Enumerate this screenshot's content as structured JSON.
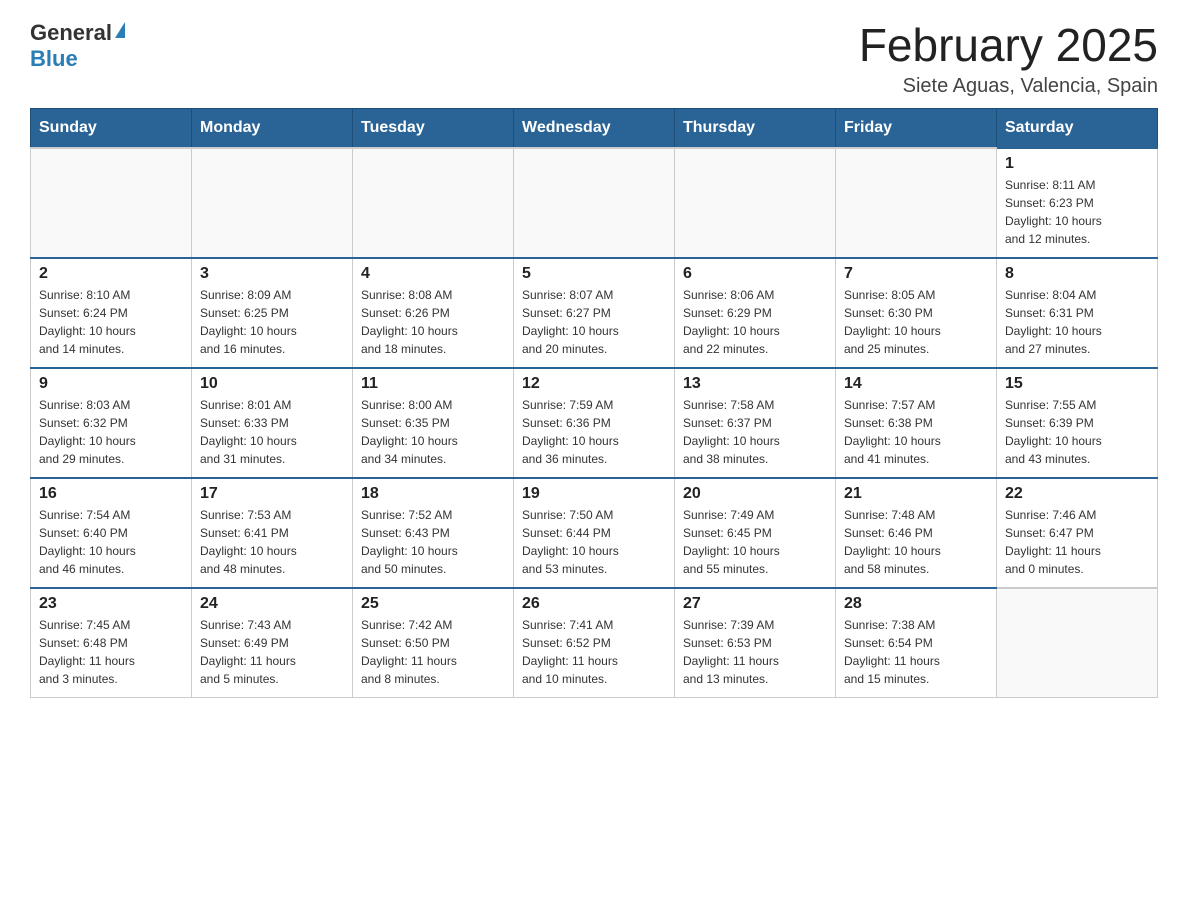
{
  "logo": {
    "general": "General",
    "blue": "Blue"
  },
  "title": "February 2025",
  "location": "Siete Aguas, Valencia, Spain",
  "weekdays": [
    "Sunday",
    "Monday",
    "Tuesday",
    "Wednesday",
    "Thursday",
    "Friday",
    "Saturday"
  ],
  "weeks": [
    [
      {
        "day": "",
        "info": ""
      },
      {
        "day": "",
        "info": ""
      },
      {
        "day": "",
        "info": ""
      },
      {
        "day": "",
        "info": ""
      },
      {
        "day": "",
        "info": ""
      },
      {
        "day": "",
        "info": ""
      },
      {
        "day": "1",
        "info": "Sunrise: 8:11 AM\nSunset: 6:23 PM\nDaylight: 10 hours\nand 12 minutes."
      }
    ],
    [
      {
        "day": "2",
        "info": "Sunrise: 8:10 AM\nSunset: 6:24 PM\nDaylight: 10 hours\nand 14 minutes."
      },
      {
        "day": "3",
        "info": "Sunrise: 8:09 AM\nSunset: 6:25 PM\nDaylight: 10 hours\nand 16 minutes."
      },
      {
        "day": "4",
        "info": "Sunrise: 8:08 AM\nSunset: 6:26 PM\nDaylight: 10 hours\nand 18 minutes."
      },
      {
        "day": "5",
        "info": "Sunrise: 8:07 AM\nSunset: 6:27 PM\nDaylight: 10 hours\nand 20 minutes."
      },
      {
        "day": "6",
        "info": "Sunrise: 8:06 AM\nSunset: 6:29 PM\nDaylight: 10 hours\nand 22 minutes."
      },
      {
        "day": "7",
        "info": "Sunrise: 8:05 AM\nSunset: 6:30 PM\nDaylight: 10 hours\nand 25 minutes."
      },
      {
        "day": "8",
        "info": "Sunrise: 8:04 AM\nSunset: 6:31 PM\nDaylight: 10 hours\nand 27 minutes."
      }
    ],
    [
      {
        "day": "9",
        "info": "Sunrise: 8:03 AM\nSunset: 6:32 PM\nDaylight: 10 hours\nand 29 minutes."
      },
      {
        "day": "10",
        "info": "Sunrise: 8:01 AM\nSunset: 6:33 PM\nDaylight: 10 hours\nand 31 minutes."
      },
      {
        "day": "11",
        "info": "Sunrise: 8:00 AM\nSunset: 6:35 PM\nDaylight: 10 hours\nand 34 minutes."
      },
      {
        "day": "12",
        "info": "Sunrise: 7:59 AM\nSunset: 6:36 PM\nDaylight: 10 hours\nand 36 minutes."
      },
      {
        "day": "13",
        "info": "Sunrise: 7:58 AM\nSunset: 6:37 PM\nDaylight: 10 hours\nand 38 minutes."
      },
      {
        "day": "14",
        "info": "Sunrise: 7:57 AM\nSunset: 6:38 PM\nDaylight: 10 hours\nand 41 minutes."
      },
      {
        "day": "15",
        "info": "Sunrise: 7:55 AM\nSunset: 6:39 PM\nDaylight: 10 hours\nand 43 minutes."
      }
    ],
    [
      {
        "day": "16",
        "info": "Sunrise: 7:54 AM\nSunset: 6:40 PM\nDaylight: 10 hours\nand 46 minutes."
      },
      {
        "day": "17",
        "info": "Sunrise: 7:53 AM\nSunset: 6:41 PM\nDaylight: 10 hours\nand 48 minutes."
      },
      {
        "day": "18",
        "info": "Sunrise: 7:52 AM\nSunset: 6:43 PM\nDaylight: 10 hours\nand 50 minutes."
      },
      {
        "day": "19",
        "info": "Sunrise: 7:50 AM\nSunset: 6:44 PM\nDaylight: 10 hours\nand 53 minutes."
      },
      {
        "day": "20",
        "info": "Sunrise: 7:49 AM\nSunset: 6:45 PM\nDaylight: 10 hours\nand 55 minutes."
      },
      {
        "day": "21",
        "info": "Sunrise: 7:48 AM\nSunset: 6:46 PM\nDaylight: 10 hours\nand 58 minutes."
      },
      {
        "day": "22",
        "info": "Sunrise: 7:46 AM\nSunset: 6:47 PM\nDaylight: 11 hours\nand 0 minutes."
      }
    ],
    [
      {
        "day": "23",
        "info": "Sunrise: 7:45 AM\nSunset: 6:48 PM\nDaylight: 11 hours\nand 3 minutes."
      },
      {
        "day": "24",
        "info": "Sunrise: 7:43 AM\nSunset: 6:49 PM\nDaylight: 11 hours\nand 5 minutes."
      },
      {
        "day": "25",
        "info": "Sunrise: 7:42 AM\nSunset: 6:50 PM\nDaylight: 11 hours\nand 8 minutes."
      },
      {
        "day": "26",
        "info": "Sunrise: 7:41 AM\nSunset: 6:52 PM\nDaylight: 11 hours\nand 10 minutes."
      },
      {
        "day": "27",
        "info": "Sunrise: 7:39 AM\nSunset: 6:53 PM\nDaylight: 11 hours\nand 13 minutes."
      },
      {
        "day": "28",
        "info": "Sunrise: 7:38 AM\nSunset: 6:54 PM\nDaylight: 11 hours\nand 15 minutes."
      },
      {
        "day": "",
        "info": ""
      }
    ]
  ]
}
